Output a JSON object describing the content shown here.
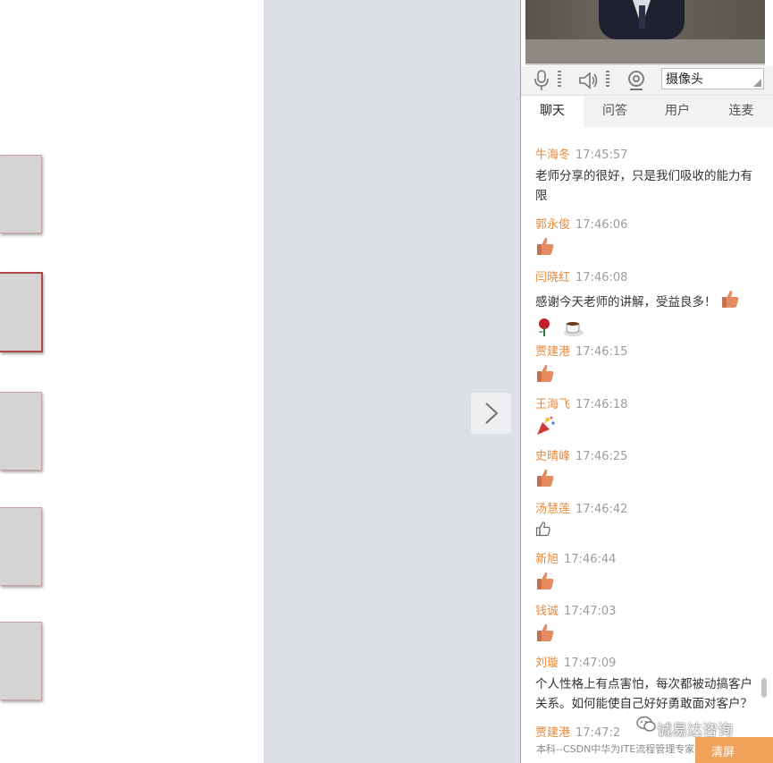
{
  "stage": {
    "next_icon": "chevron-right-icon"
  },
  "slides": [
    {
      "selected": false
    },
    {
      "selected": true
    },
    {
      "selected": false
    },
    {
      "selected": false
    },
    {
      "selected": false
    }
  ],
  "controls": {
    "mic_icon": "microphone-icon",
    "speaker_icon": "speaker-icon",
    "webcam_icon": "webcam-icon",
    "camera_select": "摄像头"
  },
  "tabs": [
    {
      "label": "聊天",
      "active": true
    },
    {
      "label": "问答",
      "active": false
    },
    {
      "label": "用户",
      "active": false
    },
    {
      "label": "连麦",
      "active": false
    }
  ],
  "messages": [
    {
      "user": "牛海冬",
      "time": "17:45:57",
      "text": "老师分享的很好，只是我们吸收的能力有限",
      "emoji": []
    },
    {
      "user": "郭永俊",
      "time": "17:46:06",
      "text": "",
      "emoji": [
        "thumbs-up-icon"
      ]
    },
    {
      "user": "闫晓红",
      "time": "17:46:08",
      "text": "感谢今天老师的讲解，受益良多！",
      "emoji": [
        "thumbs-up-icon",
        "rose-icon",
        "coffee-icon"
      ]
    },
    {
      "user": "贾建港",
      "time": "17:46:15",
      "text": "",
      "emoji": [
        "thumbs-up-icon"
      ]
    },
    {
      "user": "王海飞",
      "time": "17:46:18",
      "text": "",
      "emoji": [
        "party-popper-icon"
      ]
    },
    {
      "user": "史晴峰",
      "time": "17:46:25",
      "text": "",
      "emoji": [
        "thumbs-up-icon"
      ]
    },
    {
      "user": "汤慧莲",
      "time": "17:46:42",
      "text": "",
      "emoji": [
        "outline-thumbs-up-icon"
      ]
    },
    {
      "user": "新旭",
      "time": "17:46:44",
      "text": "",
      "emoji": [
        "thumbs-up-icon"
      ]
    },
    {
      "user": "钱诚",
      "time": "17:47:03",
      "text": "",
      "emoji": [
        "thumbs-up-icon"
      ]
    },
    {
      "user": "刘璇",
      "time": "17:47:09",
      "text": "个人性格上有点害怕，每次都被动搞客户关系。如何能使自己好好勇敢面对客户？",
      "emoji": []
    },
    {
      "user": "贾建港",
      "time": "17:47:2",
      "text": "",
      "emoji": []
    }
  ],
  "watermark": {
    "text": "诚易达咨询",
    "icon": "wechat-icon"
  },
  "footer": {
    "text": "本科--CSDN中华为ITE流程管理专家孙先明",
    "button": "清屏"
  }
}
